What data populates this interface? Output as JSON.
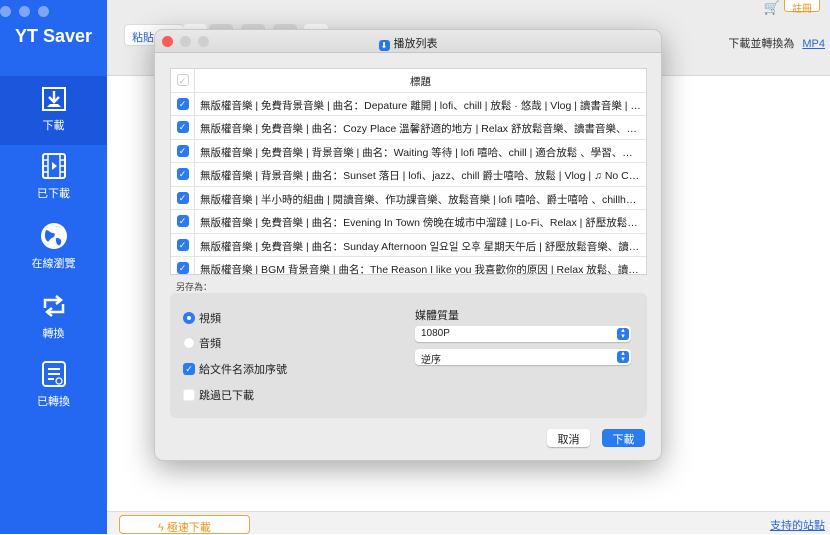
{
  "app": {
    "title": "YT Saver"
  },
  "sidebar": {
    "items": [
      {
        "label": "下載",
        "icon": "download-icon",
        "selected": true
      },
      {
        "label": "已下載",
        "icon": "film-icon"
      },
      {
        "label": "在線瀏覽",
        "icon": "globe-icon"
      },
      {
        "label": "轉換",
        "icon": "convert-icon"
      },
      {
        "label": "已轉換",
        "icon": "converted-list-icon"
      }
    ]
  },
  "toolbar": {
    "paste_label": "粘貼",
    "convert_label": "下載並轉換為",
    "format": "MP4",
    "register": "註冊"
  },
  "bottom": {
    "turbo": "極速下載",
    "sites": "支持的站點"
  },
  "dialog": {
    "title": "播放列表",
    "table": {
      "header": "標題",
      "rows": [
        "無版權音樂 | 免費背景音樂 | 曲名：Depature 離開 | lofi、chill | 放鬆 · 悠哉 | Vlog | 讀書音樂 | ♫...",
        "無版權音樂 | 免費音樂 | 曲名：Cozy Place 溫馨舒適的地方 | Relax 舒放鬆音樂、讀書音樂、睡...",
        "無版權音樂 | 免費音樂 | 背景音樂 | 曲名：Waiting 等待 | lofi 嘻哈、chill | 適合放鬆 、學習、讀...",
        "無版權音樂 | 背景音樂 | 曲名：Sunset 落日 | lofi、jazz、chill 爵士嘻哈、放鬆 | Vlog | ♫ No Co...",
        "無版權音樂 | 半小時的組曲 | 閱讀音樂、作功課音樂、放鬆音樂 | lofi 嘻哈、爵士嘻哈 、chillhop ...",
        "無版權音樂 | 免費音樂 | 曲名：Evening In Town 傍晚在城市中溜躂 | Lo-Fi、Relax | 舒壓放鬆音...",
        "無版權音樂 | 免費音樂 | 曲名：Sunday Afternoon 일요일 오후 星期天午后 | 舒壓放鬆音樂、讀書...",
        "無版權音樂 | BGM 背景音樂 | 曲名：The Reason I like you 我喜歡你的原因 | Relax 放鬆、讀書..."
      ]
    },
    "save_as": "另存為：",
    "video": "視頻",
    "audio": "音頻",
    "add_index": "給文件名添加序號",
    "skip_downloaded": "跳過已下載",
    "quality_label": "媒體質量",
    "quality": "1080P",
    "order": "逆序",
    "cancel": "取消",
    "download": "下載"
  }
}
